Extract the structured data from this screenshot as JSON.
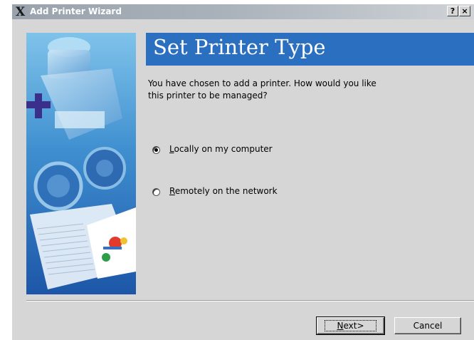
{
  "window": {
    "title": "Add Printer Wizard",
    "title_icon": "x-logo-icon",
    "help_button": "?",
    "close_button": "×"
  },
  "page": {
    "heading": "Set Printer Type",
    "description": "You have chosen to add a printer. How would you like this printer to be managed?"
  },
  "options": [
    {
      "mnemonic": "L",
      "rest": "ocally on my computer",
      "selected": true
    },
    {
      "mnemonic": "R",
      "rest": "emotely on the network",
      "selected": false
    }
  ],
  "buttons": {
    "next_mnemonic": "N",
    "next_rest": "ext>",
    "cancel": "Cancel"
  },
  "colors": {
    "header_blue": "#2a6fc0",
    "window_bg": "#d6d6d6"
  }
}
